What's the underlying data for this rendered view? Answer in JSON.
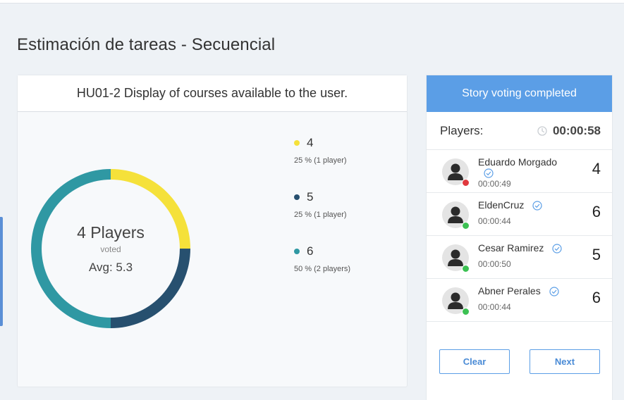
{
  "page": {
    "title": "Estimación de tareas - Secuencial"
  },
  "story": {
    "title": "HU01-2 Display of courses available to the user.",
    "summary": {
      "players": "4 Players",
      "voted": "voted",
      "avg": "Avg: 5.3"
    }
  },
  "chart_data": {
    "type": "pie",
    "categories": [
      "4",
      "5",
      "6"
    ],
    "values": [
      25,
      25,
      50
    ],
    "colors": [
      "#f5e13a",
      "#27506f",
      "#2f98a3"
    ],
    "labels": [
      "25 % (1 player)",
      "25 % (1 player)",
      "50 % (2 players)"
    ]
  },
  "legend": [
    {
      "value": "4",
      "sub": "25 % (1 player)",
      "color": "#f5e13a"
    },
    {
      "value": "5",
      "sub": "25 % (1 player)",
      "color": "#27506f"
    },
    {
      "value": "6",
      "sub": "50 % (2 players)",
      "color": "#2f98a3"
    }
  ],
  "side": {
    "status": "Story voting completed",
    "players_label": "Players:",
    "timer": "00:00:58",
    "players": [
      {
        "name": "Eduardo Morgado",
        "time": "00:00:49",
        "vote": "4",
        "status_color": "#e0393e"
      },
      {
        "name": "EldenCruz",
        "time": "00:00:44",
        "vote": "6",
        "status_color": "#3cc153"
      },
      {
        "name": "Cesar Ramirez",
        "time": "00:00:50",
        "vote": "5",
        "status_color": "#3cc153"
      },
      {
        "name": "Abner Perales",
        "time": "00:00:44",
        "vote": "6",
        "status_color": "#3cc153"
      }
    ],
    "clear_label": "Clear",
    "next_label": "Next"
  },
  "colors": {
    "accent": "#5b9ee6",
    "background": "#eef2f6"
  },
  "icons": {
    "clock": "clock-icon",
    "check": "check-circle-icon",
    "avatar": "user-avatar-icon"
  }
}
